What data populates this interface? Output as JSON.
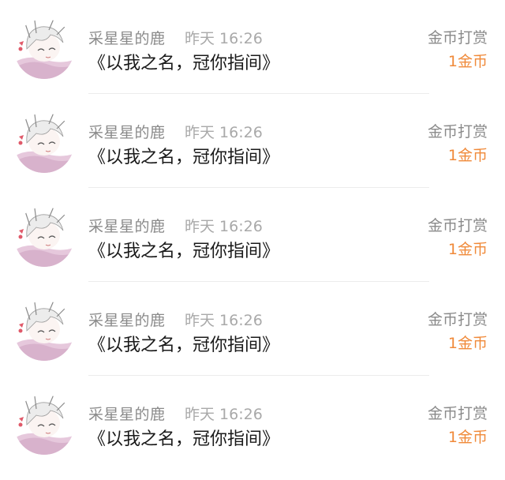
{
  "records": [
    {
      "user": "采星星的鹿",
      "time": "昨天 16:26",
      "work_title": "《以我之名，冠你指间》",
      "action": "金币打赏",
      "amount": "1金币",
      "avatar_icon": "anime-girl-avatar"
    },
    {
      "user": "采星星的鹿",
      "time": "昨天 16:26",
      "work_title": "《以我之名，冠你指间》",
      "action": "金币打赏",
      "amount": "1金币",
      "avatar_icon": "anime-girl-avatar"
    },
    {
      "user": "采星星的鹿",
      "time": "昨天 16:26",
      "work_title": "《以我之名，冠你指间》",
      "action": "金币打赏",
      "amount": "1金币",
      "avatar_icon": "anime-girl-avatar"
    },
    {
      "user": "采星星的鹿",
      "time": "昨天 16:26",
      "work_title": "《以我之名，冠你指间》",
      "action": "金币打赏",
      "amount": "1金币",
      "avatar_icon": "anime-girl-avatar"
    },
    {
      "user": "采星星的鹿",
      "time": "昨天 16:26",
      "work_title": "《以我之名，冠你指间》",
      "action": "金币打赏",
      "amount": "1金币",
      "avatar_icon": "anime-girl-avatar"
    }
  ],
  "colors": {
    "amount": "#f08a3a",
    "secondary_text": "#8a8a8a",
    "primary_text": "#1a1a1a"
  }
}
